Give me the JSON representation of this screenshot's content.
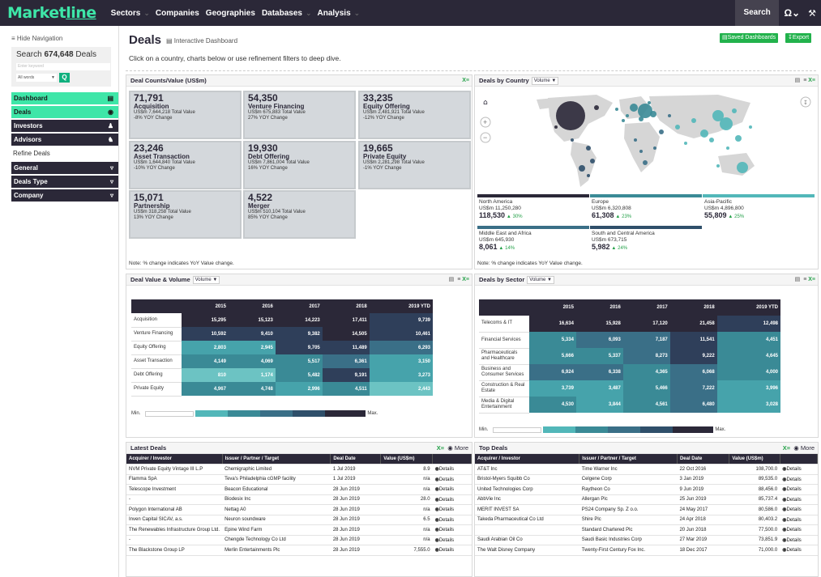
{
  "brand": "Marketline",
  "nav": [
    "Sectors",
    "Companies",
    "Geographies",
    "Databases",
    "Analysis"
  ],
  "top_right": {
    "search": "Search"
  },
  "sidebar": {
    "hide_nav": "≡ Hide Navigation",
    "search_prefix": "Search ",
    "search_count": "674,648",
    "search_suffix": " Deals",
    "keyword_placeholder": "Enter keyword",
    "words_select": "All words",
    "items": [
      {
        "label": "Dashboard",
        "icon": "dashboard-icon"
      },
      {
        "label": "Deals",
        "icon": "deals-icon"
      },
      {
        "label": "Investors",
        "icon": "investors-icon"
      },
      {
        "label": "Advisors",
        "icon": "advisors-icon"
      }
    ],
    "refine_title": "Refine Deals",
    "filters": [
      "General",
      "Deals Type",
      "Company"
    ]
  },
  "page": {
    "title": "Deals",
    "subtitle": "Interactive Dashboard",
    "hint": "Click on a country, charts below or use refinement filters to deep dive.",
    "saved_btn": "Saved Dashboards",
    "export_btn": "Export"
  },
  "counts_panel": {
    "title": "Deal Counts/Value (US$m)",
    "tiles": [
      {
        "count": "71,791",
        "label": "Acquisition",
        "value": "US$m 7,644,218 Total Value",
        "yoy": "-8% YOY Change"
      },
      {
        "count": "54,350",
        "label": "Venture Financing",
        "value": "US$m 675,883 Total Value",
        "yoy": "27% YOY Change"
      },
      {
        "count": "33,235",
        "label": "Equity Offering",
        "value": "US$m 2,481,921 Total Value",
        "yoy": "-12% YOY Change"
      },
      {
        "count": "23,246",
        "label": "Asset Transaction",
        "value": "US$m 1,644,840 Total Value",
        "yoy": "-10% YOY Change"
      },
      {
        "count": "19,930",
        "label": "Debt Offering",
        "value": "US$m 7,861,004 Total Value",
        "yoy": "16% YOY Change"
      },
      {
        "count": "19,665",
        "label": "Private Equity",
        "value": "US$m 2,281,298 Total Value",
        "yoy": "-1% YOY Change"
      },
      {
        "count": "15,071",
        "label": "Partnership",
        "value": "US$m 318,258 Total Value",
        "yoy": "13% YOY Change"
      },
      {
        "count": "4,522",
        "label": "Merger",
        "value": "US$m 510,104 Total Value",
        "yoy": "85% YOY Change"
      }
    ],
    "note": "Note: % change indicates YoY Value change."
  },
  "country_panel": {
    "title": "Deals by Country",
    "select": "Volume",
    "regions": [
      {
        "name": "North America",
        "value": "US$m 11,250,280",
        "count": "118,530",
        "change": "30%",
        "color": "#2b2838"
      },
      {
        "name": "Europe",
        "value": "US$m 6,320,808",
        "count": "61,308",
        "change": "23%",
        "color": "#3a8a96"
      },
      {
        "name": "Asia-Pacific",
        "value": "US$m 4,896,800",
        "count": "55,809",
        "change": "25%",
        "color": "#52b7b9"
      },
      {
        "name": "Middle East and Africa",
        "value": "US$m 645,930",
        "count": "8,061",
        "change": "14%",
        "color": "#3a6f87"
      },
      {
        "name": "South and Central America",
        "value": "US$m 673,715",
        "count": "5,982",
        "change": "24%",
        "color": "#2f4f6a"
      }
    ],
    "note": "Note: % change indicates YoY Value change."
  },
  "value_volume": {
    "title": "Deal Value & Volume",
    "select": "Volume",
    "years": [
      "2015",
      "2016",
      "2017",
      "2018",
      "2019 YTD"
    ],
    "rows": [
      {
        "label": "Acquisition",
        "values": [
          "15,295",
          "15,123",
          "14,223",
          "17,411",
          "9,739"
        ]
      },
      {
        "label": "Venture Financing",
        "values": [
          "10,592",
          "9,410",
          "9,382",
          "14,505",
          "10,461"
        ]
      },
      {
        "label": "Equity Offering",
        "values": [
          "2,803",
          "2,945",
          "9,705",
          "11,489",
          "6,293"
        ]
      },
      {
        "label": "Asset Transaction",
        "values": [
          "4,149",
          "4,069",
          "5,517",
          "6,361",
          "3,150"
        ]
      },
      {
        "label": "Debt Offering",
        "values": [
          "810",
          "1,174",
          "5,482",
          "9,191",
          "3,273"
        ]
      },
      {
        "label": "Private Equity",
        "values": [
          "4,967",
          "4,748",
          "2,996",
          "4,511",
          "2,443"
        ]
      }
    ],
    "min_label": "Min.",
    "max_label": "Max."
  },
  "sector_panel": {
    "title": "Deals by Sector",
    "select": "Volume",
    "years": [
      "2015",
      "2016",
      "2017",
      "2018",
      "2019 YTD"
    ],
    "rows": [
      {
        "label": "Telecoms & IT",
        "values": [
          "16,634",
          "15,928",
          "17,120",
          "21,458",
          "12,498"
        ]
      },
      {
        "label": "Financial Services",
        "values": [
          "5,334",
          "6,093",
          "7,187",
          "11,541",
          "4,451"
        ]
      },
      {
        "label": "Pharmaceuticals and Healthcare",
        "values": [
          "5,666",
          "5,337",
          "8,273",
          "9,222",
          "4,645"
        ]
      },
      {
        "label": "Business and Consumer Services",
        "values": [
          "6,924",
          "6,338",
          "4,365",
          "6,068",
          "4,000"
        ]
      },
      {
        "label": "Construction & Real Estate",
        "values": [
          "3,739",
          "3,487",
          "5,466",
          "7,222",
          "3,996"
        ]
      },
      {
        "label": "Media & Digital Entertainment",
        "values": [
          "4,530",
          "3,844",
          "4,561",
          "6,480",
          "3,028"
        ]
      }
    ],
    "min_label": "Min.",
    "max_label": "Max."
  },
  "latest_deals": {
    "title": "Latest Deals",
    "more": "More",
    "columns": [
      "Acquirer / Investor",
      "Issuer / Partner / Target",
      "Deal Date",
      "Value (US$m)",
      ""
    ],
    "rows": [
      [
        "NVM Private Equity Vintage III L.P",
        "Chemigraphic Limited",
        "1 Jul 2019",
        "8.9",
        "Details"
      ],
      [
        "Flamma SpA",
        "Teva's Philadelphia cGMP facility",
        "1 Jul 2019",
        "n/a",
        "Details"
      ],
      [
        "Telescope Investment",
        "Beacon Educational",
        "28 Jun 2019",
        "n/a",
        "Details"
      ],
      [
        "-",
        "Biodesix Inc",
        "28 Jun 2019",
        "28.0",
        "Details"
      ],
      [
        "Polygon International AB",
        "Nettag A0",
        "28 Jun 2019",
        "n/a",
        "Details"
      ],
      [
        "Inven Capital SICAV, a.s.",
        "Neuron soundware",
        "28 Jun 2019",
        "6.5",
        "Details"
      ],
      [
        "The Renewables Infrastructure Group Ltd.",
        "Epine Wind Farm",
        "28 Jun 2019",
        "n/a",
        "Details"
      ],
      [
        "-",
        "Chengde Technology Co Ltd",
        "28 Jun 2019",
        "n/a",
        "Details"
      ],
      [
        "The Blackstone Group LP",
        "Merlin Entertainments Plc",
        "28 Jun 2019",
        "7,555.0",
        "Details"
      ]
    ]
  },
  "top_deals": {
    "title": "Top Deals",
    "more": "More",
    "columns": [
      "Acquirer / Investor",
      "Issuer / Partner / Target",
      "Deal Date",
      "Value (US$m)",
      ""
    ],
    "rows": [
      [
        "AT&T Inc",
        "Time Warner Inc",
        "22 Oct 2016",
        "108,700.0",
        "Details"
      ],
      [
        "Bristol-Myers Squibb Co",
        "Celgene Corp",
        "3 Jan 2019",
        "89,535.0",
        "Details"
      ],
      [
        "United Technologies Corp",
        "Raytheon Co",
        "9 Jun 2019",
        "88,456.0",
        "Details"
      ],
      [
        "AbbVie Inc",
        "Allergan Plc",
        "25 Jun 2019",
        "85,737.4",
        "Details"
      ],
      [
        "MERIT INVEST SA",
        "PS24 Company Sp. Z o.o.",
        "24 May 2017",
        "80,586.0",
        "Details"
      ],
      [
        "Takeda Pharmaceutical Co Ltd",
        "Shire Plc",
        "24 Apr 2018",
        "80,403.2",
        "Details"
      ],
      [
        "",
        "Standard Chartered Plc",
        "20 Jun 2018",
        "77,500.0",
        "Details"
      ],
      [
        "Saudi Arabian Oil Co",
        "Saudi Basic Industries Corp",
        "27 Mar 2019",
        "73,851.9",
        "Details"
      ],
      [
        "The Walt Disney Company",
        "Twenty-First Century Fox Inc.",
        "18 Dec 2017",
        "71,000.0",
        "Details"
      ]
    ]
  },
  "colors": {
    "brand_green": "#3ee6a8",
    "dark": "#2b2838",
    "teal": "#52b7b9"
  }
}
